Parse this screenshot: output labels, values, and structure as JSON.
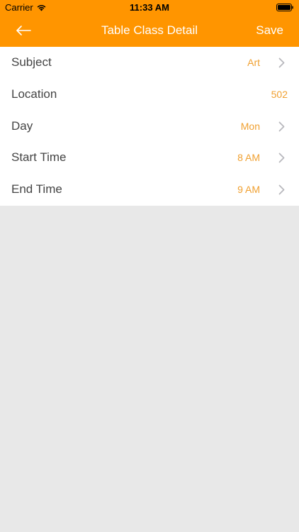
{
  "status_bar": {
    "carrier": "Carrier",
    "time": "11:33 AM"
  },
  "nav": {
    "title": "Table Class Detail",
    "save_label": "Save",
    "back_icon": "back-arrow-icon"
  },
  "rows": [
    {
      "label": "Subject",
      "value": "Art",
      "has_chevron": true
    },
    {
      "label": "Location",
      "value": "502",
      "has_chevron": false
    },
    {
      "label": "Day",
      "value": "Mon",
      "has_chevron": true
    },
    {
      "label": "Start Time",
      "value": "8 AM",
      "has_chevron": true
    },
    {
      "label": "End Time",
      "value": "9 AM",
      "has_chevron": true
    }
  ],
  "colors": {
    "accent": "#ff9500",
    "value_text": "#f0a030",
    "background": "#e8e8e8"
  }
}
